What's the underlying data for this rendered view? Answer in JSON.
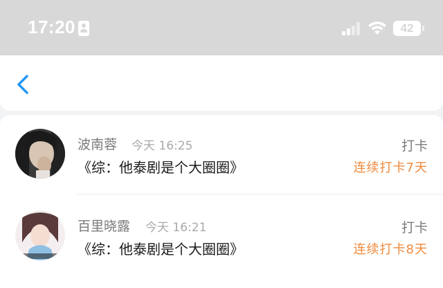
{
  "status_bar": {
    "time": "17:20",
    "battery": "42",
    "icons": [
      "id-card-icon",
      "cellular-signal-icon",
      "wifi-icon",
      "battery-icon"
    ]
  },
  "nav": {
    "back_icon": "chevron-left-icon",
    "accent": "#2196f3"
  },
  "colors": {
    "streak": "#f08a3c",
    "name": "#7a7a7a",
    "title": "#1a1a1a"
  },
  "items": [
    {
      "name": "波南蓉",
      "time": "今天 16:25",
      "title": "《综：他泰剧是个大圈圈》",
      "type": "打卡",
      "streak": "连续打卡7天"
    },
    {
      "name": "百里晓露",
      "time": "今天 16:21",
      "title": "《综：他泰剧是个大圈圈》",
      "type": "打卡",
      "streak": "连续打卡8天"
    }
  ]
}
